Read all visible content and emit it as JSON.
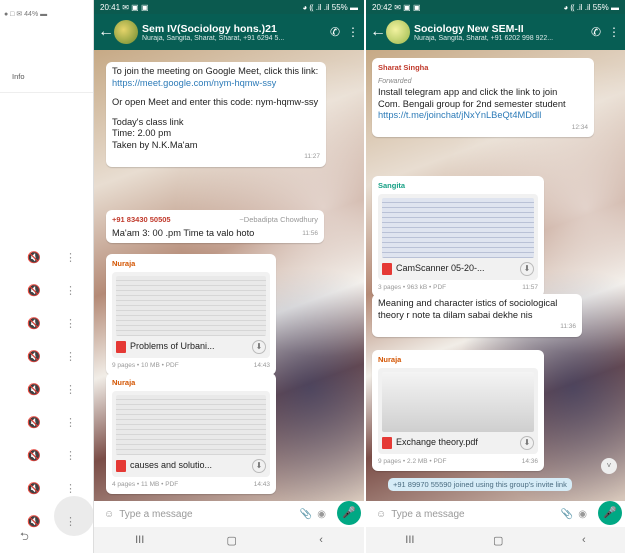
{
  "left": {
    "status": "● □ ✉ 44% ▬",
    "info_label": "Info",
    "mute_icon": "🔇",
    "more_icon": "⋮",
    "rows": 9,
    "back_icon": "⮌"
  },
  "panel1": {
    "status_time": "20:41 ✉ ▣ ▣",
    "status_right": "◕ ⸨ .il .il 55% ▬",
    "title": "Sem IV(Sociology hons.)21",
    "subtitle": "Nuraja, Sangita, Sharat, Sharat, +91 6294 5...",
    "messages": {
      "m1": {
        "line1": "To join the meeting on Google Meet, click this link:",
        "link": "https://meet.google.com/nym-hqmw-ssy",
        "line2": "Or open Meet and enter this code: nym-hqmw-ssy",
        "line3": "Today's class link",
        "line4": "Time: 2.00 pm",
        "line5": "Taken by N.K.Ma'am",
        "time": "11:27"
      },
      "m2": {
        "sender": "+91 83430 50505",
        "sender_name": "~Debadipta Chowdhury",
        "text": "Ma'am 3: 00 .pm Time ta valo hoto",
        "time": "11:56"
      },
      "m3": {
        "sender": "Nuraja",
        "doc_name": "Problems of Urbani...",
        "meta": "9 pages • 10 MB • PDF",
        "time": "14:43"
      },
      "m4": {
        "sender": "Nuraja",
        "doc_name": "causes and solutio...",
        "meta": "4 pages • 11 MB • PDF",
        "time": "14:43"
      }
    }
  },
  "panel2": {
    "status_time": "20:42 ✉ ▣ ▣",
    "status_right": "◕ ⸨ .il .il 55% ▬",
    "title": "Sociology New SEM-II",
    "subtitle": "Nuraja, Sangita, Sharat, +91 6202 998 922...",
    "messages": {
      "m1": {
        "sender": "Sharat Singha",
        "forwarded": "Forwarded",
        "text": "Install telegram app and click the link to join",
        "text2": "Com. Bengali group for 2nd semester student",
        "link": "https://t.me/joinchat/jNxYnLBeQt4MDdll",
        "time": "12:34"
      },
      "m2": {
        "sender": "Sangita",
        "doc_name": "CamScanner 05-20-...",
        "meta": "3 pages • 963 kB • PDF",
        "time": "11:57"
      },
      "m3": {
        "text": "Meaning and character istics of sociological theory r note ta dilam sabai dekhe nis",
        "time": "11:36"
      },
      "m4": {
        "sender": "Nuraja",
        "doc_name": "Exchange theory.pdf",
        "meta": "9 pages • 2.2 MB • PDF",
        "time": "14:36"
      },
      "notice": "+91 89970 55590 joined using this group's invite link"
    }
  },
  "common": {
    "input_placeholder": "Type a message",
    "emoji_icon": "☺",
    "attach_icon": "📎",
    "camera_icon": "◉",
    "mic_icon": "🎤",
    "back_arrow": "←",
    "call_icon": "✆",
    "menu_icon": "⋮",
    "nav_recent": "III",
    "nav_home": "▢",
    "nav_back": "‹",
    "download_icon": "⬇",
    "scroll_icon": "˅"
  },
  "colors": {
    "header": "#075e54",
    "accent": "#00a884",
    "link": "#2d7bb8"
  }
}
